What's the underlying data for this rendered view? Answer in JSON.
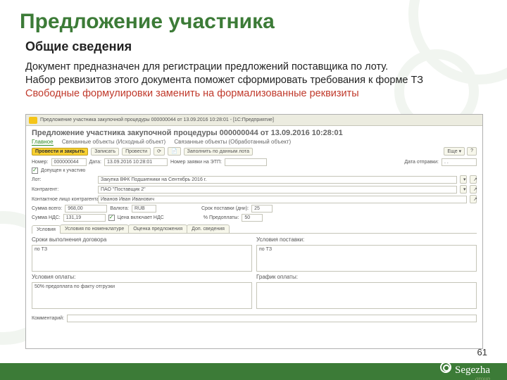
{
  "title": "Предложение участника",
  "subtitle": "Общие сведения",
  "body_line1": "Документ предназначен для регистрации предложений поставщика по лоту.",
  "body_line2": "Набор реквизитов этого документа поможет сформировать требования к форме ТЗ",
  "body_red": "Свободные формулировки заменить на формализованные реквизиты",
  "page_number": "61",
  "logo": {
    "name": "Segezha",
    "suffix": "group"
  },
  "ss": {
    "window_title": "Предложение участника закупочной процедуры 000000044 от 13.09.2016 10:28:01 - [1С:Предприятие]",
    "doc_title": "Предложение участника закупочной процедуры 000000044 от 13.09.2016 10:28:01",
    "tabs1": {
      "main": "Главное",
      "linked1": "Связанные объекты (Исходный объект)",
      "linked2": "Связанные объекты (Обработанный объект)"
    },
    "toolbar": {
      "main_action": "Провести и закрыть",
      "write": "Записать",
      "post": "Провести",
      "fill": "Заполнить по данным лота",
      "more": "Еще ▾",
      "help": "?"
    },
    "row1": {
      "num_lbl": "Номер:",
      "num": "000000044",
      "date_lbl": "Дата:",
      "date": "13.09.2016 10:28:01",
      "etp_lbl": "Номер заявки на ЭТП:",
      "etp": "",
      "send_date_lbl": "Дата отправки:",
      "send_date": "   .   .   "
    },
    "row_chk": {
      "lbl": "Допущен к участию"
    },
    "row_lot": {
      "lbl": "Лот:",
      "val": "Закупка ВФК Подшипники на Сентябрь 2016 г."
    },
    "row_cp": {
      "lbl": "Контрагент:",
      "val": "ПАО \"Поставщик 2\""
    },
    "row_contact": {
      "lbl": "Контактное лицо контрагента:",
      "val": "Иванов Иван Иванович"
    },
    "row_sums": {
      "sum_lbl": "Сумма всего:",
      "sum": "968,00",
      "cur_lbl": "Валюта:",
      "cur": "RUB",
      "deliv_lbl": "Срок поставки (дни):",
      "deliv": "25"
    },
    "row_vat": {
      "vat_lbl": "Сумма НДС:",
      "vat": "131,19",
      "incvat": "Цена включает НДС",
      "prepay_lbl": "% Предоплаты:",
      "prepay": "50"
    },
    "tabs2": {
      "t1": "Условия",
      "t2": "Условия по номенклатуре",
      "t3": "Оценка предложения",
      "t4": "Доп. сведения"
    },
    "grid": {
      "l1_lbl": "Сроки выполнения договора",
      "r1_lbl": "Условия поставки:",
      "l1_val": "по ТЗ",
      "r1_val": "по ТЗ",
      "l2_lbl": "Условия оплаты:",
      "r2_lbl": "График оплаты:",
      "l2_val": "50% предоплата по факту отгрузки",
      "r2_val": ""
    },
    "comment_lbl": "Комментарий:"
  }
}
